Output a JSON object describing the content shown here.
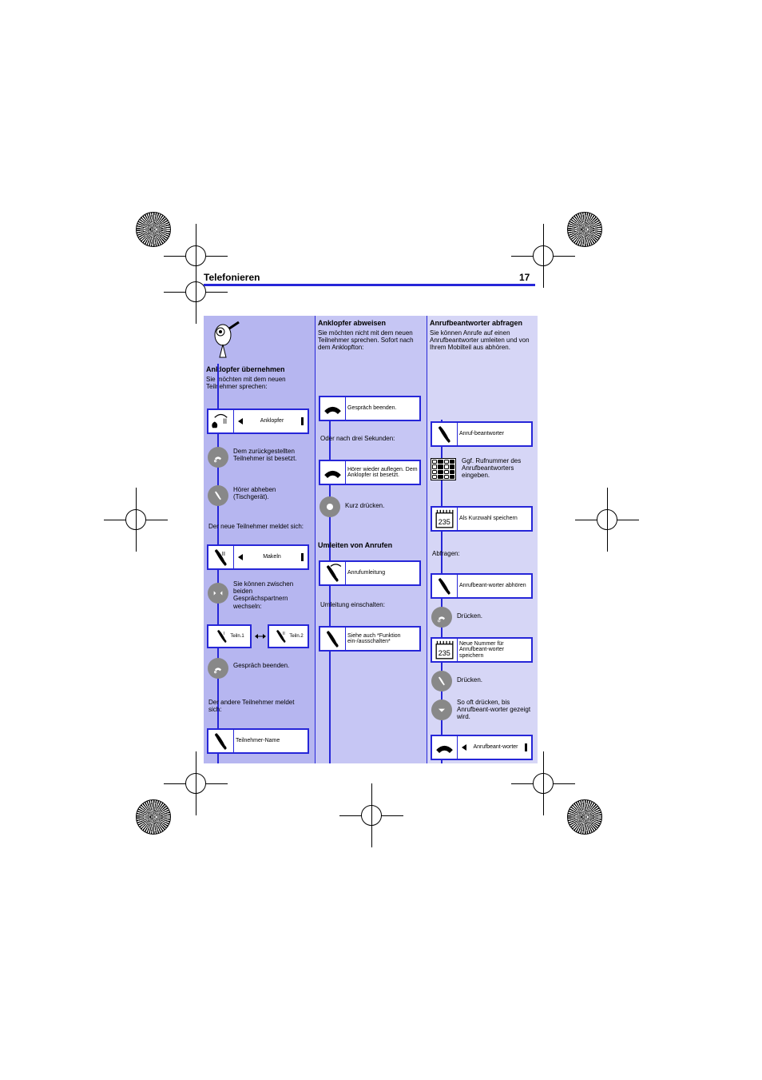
{
  "header": {
    "title": "Telefonieren",
    "page": "17"
  },
  "col1": {
    "heading": "Anklopfer übernehmen",
    "intro": "Sie möchten mit dem neuen Teilnehmer sprechen:",
    "box1_label": "Anklopfer",
    "btn1_label": "Dem zurückgestellten Teilnehmer ist besetzt.",
    "btn2_label": "Hörer abheben (Tischgerät).",
    "bridge1": "Der neue Teilnehmer meldet sich:",
    "box2_label": "Makeln",
    "btn3_label": "Sie können zwischen beiden Gesprächspartnern wechseln:",
    "dual_left": "Teiln.1",
    "dual_right": "Teiln.2",
    "btn4_label": "Gespräch beenden.",
    "bridge2": "Der andere Teilnehmer meldet sich:",
    "box3_label": "Teilnehmer-Name"
  },
  "col2": {
    "heading": "Anklopfer abweisen",
    "intro": "Sie möchten nicht mit dem neuen Teilnehmer sprechen. Sofort nach dem Anklopfton:",
    "box1_label": "Gespräch beenden.",
    "bridge1": "Oder nach drei Sekunden:",
    "box2_label": "Hörer wieder auflegen. Dem Anklopfer ist besetzt.",
    "btn1_label": "Kurz drücken.",
    "heading2": "Umleiten von Anrufen",
    "box3_label": "Anrufumleitung",
    "bridge2": "Umleitung einschalten:",
    "box4_label": "Siehe auch *Funktion ein-/ausschalten*"
  },
  "col3": {
    "heading": "Anrufbeantworter abfragen",
    "intro": "Sie können Anrufe auf einen Anrufbeantworter umleiten und von Ihrem Mobilteil aus abhören.",
    "box1_label": "Anruf-beantworter",
    "keypad_label": "Ggf. Rufnummer des Anrufbeantworters eingeben.",
    "box2_label": "Als Kurzwahl speichern",
    "bridge1": "Abfragen:",
    "box3_label": "Anrufbeant-worter abhören",
    "btn1_label": "Drücken.",
    "box4_label": "Neue Nummer für Anrufbeant-worter speichern",
    "btn2_label": "Drücken.",
    "btn3_label": "So oft drücken, bis Anrufbeant-worter gezeigt wird.",
    "box5_label": "Anrufbeant-worter"
  }
}
